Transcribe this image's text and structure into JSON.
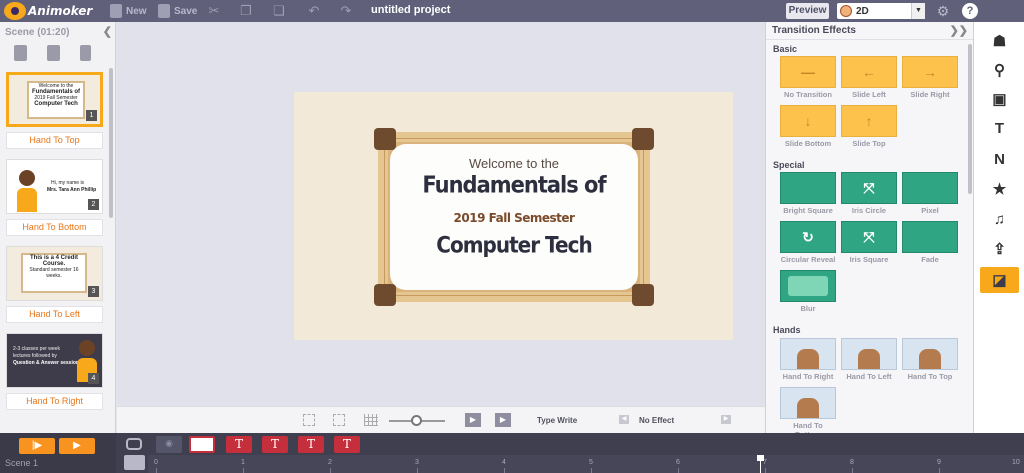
{
  "app": {
    "logo_text": "Animoker",
    "project_title": "untitled project",
    "toolbar": {
      "new_label": "New",
      "save_label": "Save",
      "preview_label": "Preview",
      "mode_value": "2D"
    }
  },
  "scene_panel": {
    "header": "Scene  (01:20)",
    "scenes": [
      {
        "transition": "Hand To Top",
        "num": "1",
        "lines": [
          "Welcome to the",
          "Fundamentals of",
          "2019 Fall Semester",
          "Computer Tech"
        ]
      },
      {
        "transition": "Hand To Bottom",
        "num": "2",
        "lines": [
          "Hi, my name is",
          "Mrs. Tara Ann Phillip"
        ]
      },
      {
        "transition": "Hand To Left",
        "num": "3",
        "lines": [
          "This is a 4 Credit Course.",
          "Standard semester 16 weeks."
        ]
      },
      {
        "transition": "Hand To Right",
        "num": "4",
        "lines": [
          "2-3 classes per week",
          "lectures followed by",
          "Question & Answer sessions"
        ]
      }
    ]
  },
  "stage": {
    "board": {
      "welcome": "Welcome to the",
      "title": "Fundamentals of",
      "semester": "2019 Fall Semester",
      "course": "Computer Tech"
    },
    "toolbar": {
      "enter_effect": "Type Write",
      "exit_effect": "No Effect"
    }
  },
  "fx_panel": {
    "title": "Transition Effects",
    "sections": {
      "basic": "Basic",
      "special": "Special",
      "hands": "Hands"
    },
    "basic": [
      {
        "label": "No Transition",
        "glyph": "—"
      },
      {
        "label": "Slide Left",
        "glyph": "←"
      },
      {
        "label": "Slide Right",
        "glyph": "→"
      },
      {
        "label": "Slide Bottom",
        "glyph": "↓"
      },
      {
        "label": "Slide Top",
        "glyph": "↑"
      }
    ],
    "special": [
      {
        "label": "Bright Square"
      },
      {
        "label": "Iris Circle"
      },
      {
        "label": "Pixel"
      },
      {
        "label": "Circular Reveal"
      },
      {
        "label": "Iris Square"
      },
      {
        "label": "Fade"
      },
      {
        "label": "Blur"
      }
    ],
    "hands": [
      {
        "label": "Hand To Right"
      },
      {
        "label": "Hand To Left"
      },
      {
        "label": "Hand To Top"
      },
      {
        "label": "Hand To Bottom"
      }
    ]
  },
  "timeline": {
    "scene_label": "Scene 1",
    "ticks": [
      "0",
      "1",
      "2",
      "3",
      "4",
      "5",
      "6",
      "7",
      "8",
      "9",
      "10"
    ]
  },
  "colors": {
    "accent": "#f7a81b",
    "topbar": "#60607a",
    "transition_yellow": "#fcc24b",
    "transition_green": "#2fa583",
    "timeline_red": "#c42f3b"
  }
}
